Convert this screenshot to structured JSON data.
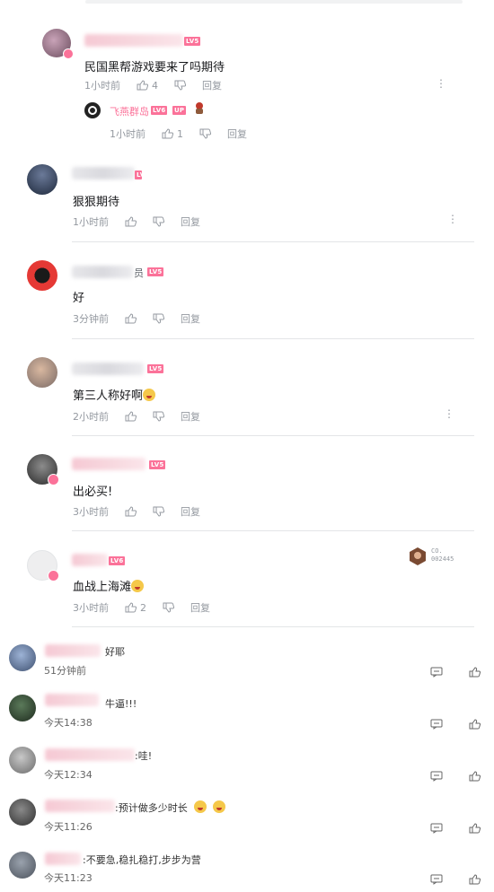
{
  "replies": [
    {
      "content": "民国黑帮游戏要来了吗期待",
      "time": "1小时前",
      "likes": "4",
      "reply_label": "回复",
      "level": "LV5"
    },
    {
      "content": "",
      "time": "1小时前",
      "likes": "1",
      "reply_label": "回复",
      "name": "飞燕群岛",
      "level": "LV6",
      "up_badge": "UP"
    },
    {
      "content": "狠狠期待",
      "time": "1小时前",
      "likes": "",
      "reply_label": "回复",
      "level": "LV6"
    },
    {
      "content": "好",
      "time": "3分钟前",
      "likes": "",
      "reply_label": "回复",
      "name_suffix": "员",
      "level": "LV5"
    },
    {
      "content": "第三人称好啊",
      "time": "2小时前",
      "likes": "",
      "reply_label": "回复",
      "level": "LV5"
    },
    {
      "content": "出必买!",
      "time": "3小时前",
      "likes": "",
      "reply_label": "回复",
      "level": "LV5"
    },
    {
      "content": "血战上海滩",
      "time": "3小时前",
      "likes": "2",
      "reply_label": "回复",
      "level": "LV6",
      "badge_text": "CO. 002445"
    }
  ],
  "weibo_comments": [
    {
      "text": "好耶",
      "time": "51分钟前"
    },
    {
      "text": "牛逼!!!",
      "time": "今天14:38"
    },
    {
      "text": ":哇!",
      "time": "今天12:34"
    },
    {
      "text": ":预计做多少时长",
      "time": "今天11:26"
    },
    {
      "text": ":不要急,稳扎稳打,步步为营",
      "time": "今天11:23"
    }
  ]
}
